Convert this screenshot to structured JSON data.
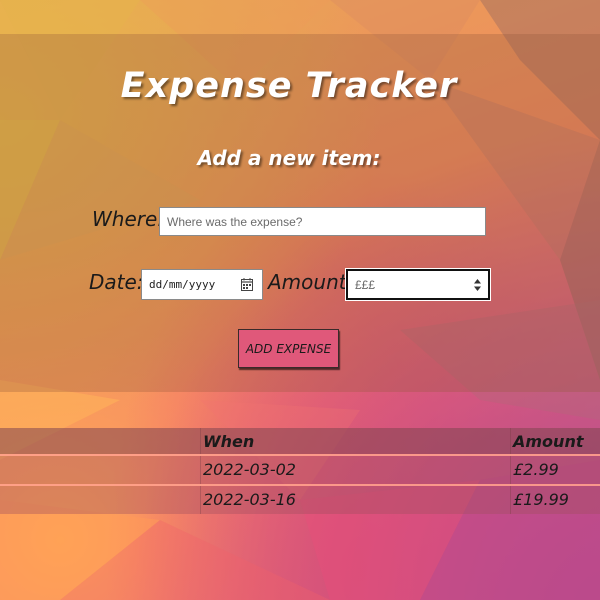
{
  "app": {
    "title": "Expense Tracker",
    "subtitle": "Add a new item:"
  },
  "form": {
    "where_label": "Where:",
    "where_placeholder": "Where was the expense?",
    "date_label": "Date:",
    "date_placeholder": "dd/mm/yyyy",
    "amount_label": "Amount:",
    "amount_placeholder": "£££",
    "add_button": "ADD EXPENSE"
  },
  "table": {
    "columns": [
      "",
      "When",
      "Amount"
    ],
    "rows": [
      {
        "where": "",
        "when": "2022-03-02",
        "amount": "£2.99"
      },
      {
        "where": "",
        "when": "2022-03-16",
        "amount": "£19.99"
      }
    ]
  },
  "colors": {
    "button": "#e0587a",
    "title_text": "#ffffff"
  },
  "icons": {
    "date_picker": "calendar-icon",
    "amount_spinner": "spinner-arrows-icon"
  }
}
